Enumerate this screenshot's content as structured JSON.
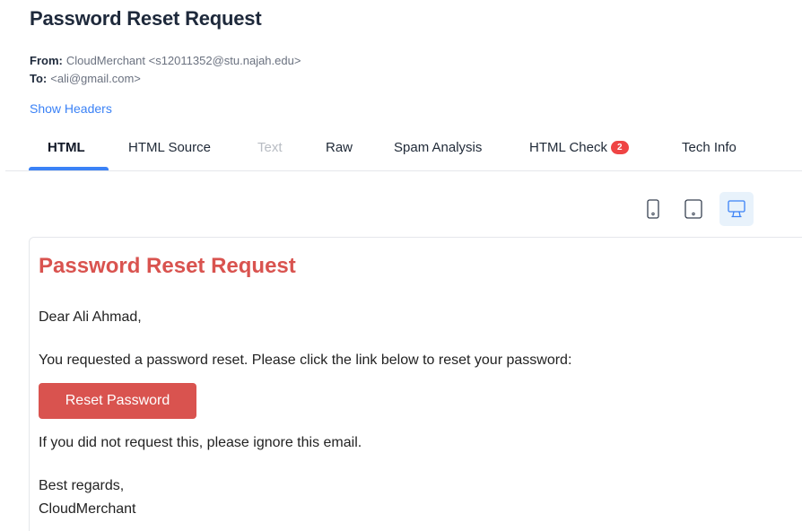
{
  "email": {
    "subject": "Password Reset Request",
    "from_label": "From:",
    "from_value": "CloudMerchant <s12011352@stu.najah.edu>",
    "to_label": "To:",
    "to_value": "<ali@gmail.com>",
    "show_headers": "Show Headers"
  },
  "tabs": [
    {
      "label": "HTML",
      "state": "active"
    },
    {
      "label": "HTML Source",
      "state": "normal"
    },
    {
      "label": "Text",
      "state": "disabled"
    },
    {
      "label": "Raw",
      "state": "normal"
    },
    {
      "label": "Spam Analysis",
      "state": "normal"
    },
    {
      "label": "HTML Check",
      "state": "normal",
      "badge": "2"
    },
    {
      "label": "Tech Info",
      "state": "normal"
    }
  ],
  "devices": [
    {
      "icon": "mobile-icon",
      "selected": false
    },
    {
      "icon": "tablet-icon",
      "selected": false
    },
    {
      "icon": "desktop-icon",
      "selected": true
    }
  ],
  "preview": {
    "title": "Password Reset Request",
    "greeting": "Dear Ali Ahmad,",
    "body": "You requested a password reset. Please click the link below to reset your password:",
    "button_label": "Reset Password",
    "ignore_note": "If you did not request this, please ignore this email.",
    "signoff": "Best regards,",
    "signature": "CloudMerchant"
  },
  "colors": {
    "accent": "#3b82f6",
    "badge": "#ef4444",
    "email_red": "#d9534f"
  }
}
